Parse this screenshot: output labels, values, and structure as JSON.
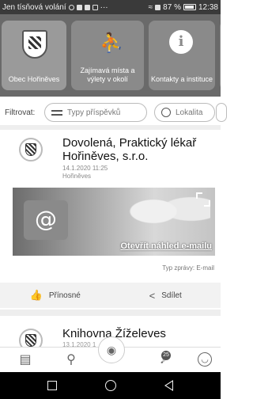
{
  "status_bar": {
    "carrier": "Jen tísňová volání",
    "battery": "87 %",
    "time": "12:38"
  },
  "tiles": [
    {
      "label": "Obec Hořiněves",
      "icon": "crest-icon"
    },
    {
      "label": "Zajímavá místa a výlety v okolí",
      "icon": "hiker-icon"
    },
    {
      "label": "Kontakty a instituce",
      "icon": "info-icon",
      "glyph": "i"
    }
  ],
  "filter": {
    "label": "Filtrovat:",
    "types_placeholder": "Typy příspěvků",
    "location_label": "Lokalita"
  },
  "posts": [
    {
      "title": "Dovolená, Praktický lékař Hořiněves, s.r.o.",
      "date": "14.1.2020 11:25",
      "place": "Hořiněves",
      "email_link": "Otevřít náhled e-mailu",
      "message_type": "Typ zprávy: E-mail",
      "actions": {
        "useful": "Přínosné",
        "share": "Sdílet"
      }
    },
    {
      "title": "Knihovna Žíželeves",
      "date": "13.1.2020 1"
    }
  ],
  "bottom_nav": {
    "notification_count": "25"
  }
}
